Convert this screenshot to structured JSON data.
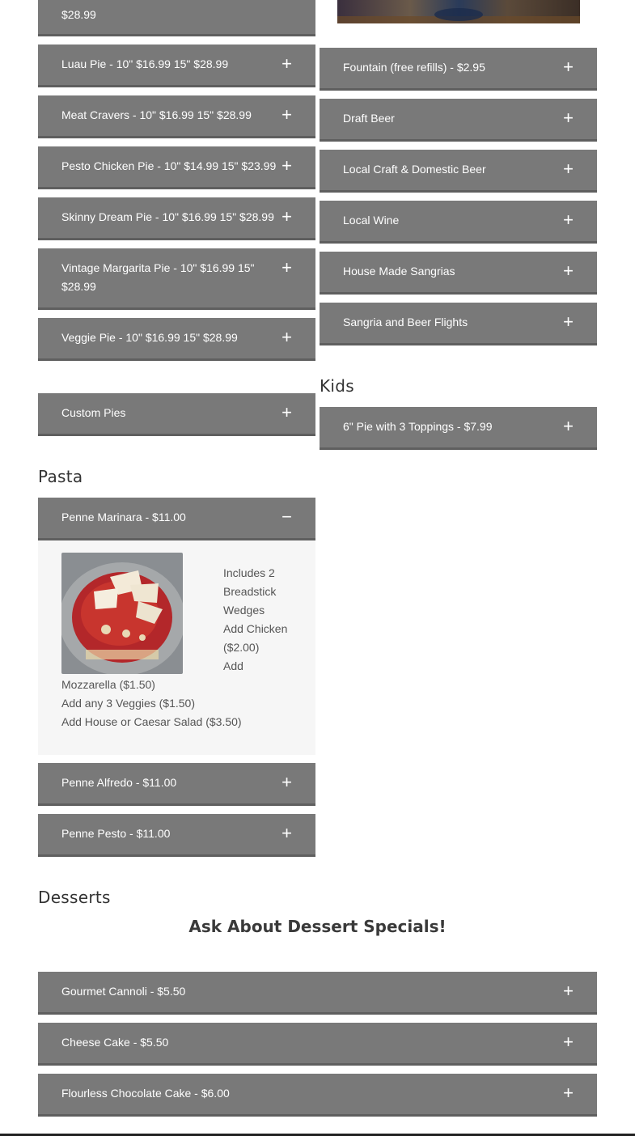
{
  "pizza": {
    "partial_item": {
      "label": "$28.99"
    },
    "items": [
      {
        "label": "Luau Pie - 10\" $16.99 15\" $28.99",
        "icon": "+"
      },
      {
        "label": "Meat Cravers - 10\" $16.99 15\" $28.99",
        "icon": "+"
      },
      {
        "label": "Pesto Chicken Pie - 10\" $14.99 15\" $23.99",
        "icon": "+"
      },
      {
        "label": "Skinny Dream Pie - 10\" $16.99 15\" $28.99",
        "icon": "+"
      },
      {
        "label": "Vintage Margarita Pie - 10\" $16.99 15\" $28.99",
        "icon": "+"
      },
      {
        "label": "Veggie Pie - 10\" $16.99 15\" $28.99",
        "icon": "+"
      }
    ],
    "custom": {
      "label": "Custom Pies",
      "icon": "+"
    }
  },
  "pasta": {
    "heading": "Pasta",
    "expanded": {
      "label": "Penne Marinara - $11.00",
      "icon": "−",
      "lines": [
        "Includes 2",
        "Breadstick",
        "Wedges",
        "Add Chicken",
        "($2.00)",
        "Add",
        "Mozzarella ($1.50)",
        "Add any 3 Veggies ($1.50)",
        "Add House or Caesar Salad ($3.50)"
      ]
    },
    "items": [
      {
        "label": "Penne Alfredo - $11.00",
        "icon": "+"
      },
      {
        "label": "Penne Pesto - $11.00",
        "icon": "+"
      }
    ]
  },
  "drinks": {
    "items": [
      {
        "label": "Fountain (free refills) - $2.95",
        "icon": "+"
      },
      {
        "label": "Draft Beer",
        "icon": "+"
      },
      {
        "label": "Local Craft & Domestic Beer",
        "icon": "+"
      },
      {
        "label": "Local Wine",
        "icon": "+"
      },
      {
        "label": "House Made Sangrias",
        "icon": "+"
      },
      {
        "label": "Sangria and Beer Flights",
        "icon": "+"
      }
    ]
  },
  "kids": {
    "heading": "Kids",
    "items": [
      {
        "label": "6\" Pie with 3 Toppings - $7.99",
        "icon": "+"
      }
    ]
  },
  "desserts": {
    "heading": "Desserts",
    "special": "Ask About Dessert Specials!",
    "items": [
      {
        "label": "Gourmet Cannoli - $5.50",
        "icon": "+"
      },
      {
        "label": "Cheese Cake - $5.50",
        "icon": "+"
      },
      {
        "label": "Flourless Chocolate Cake - $6.00",
        "icon": "+"
      }
    ]
  },
  "colors": {
    "accordion_bg": "#797979",
    "panel_bg": "#f6f6f6",
    "text": "#555555"
  }
}
